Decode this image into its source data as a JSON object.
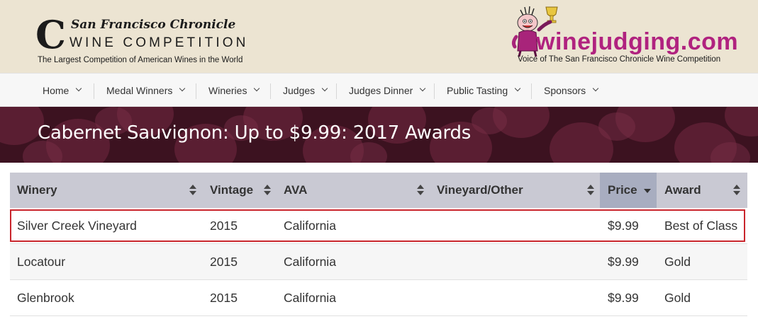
{
  "header": {
    "logo_letter": "C",
    "paper_name": "San Francisco Chronicle",
    "competition": "WINE COMPETITION",
    "tagline": "The Largest Competition of American Wines in the World",
    "winejudging_logo": "winejudging.com",
    "winejudging_voice": "Voice of The San Francisco Chronicle Wine Competition"
  },
  "nav": {
    "items": [
      {
        "label": "Home"
      },
      {
        "label": "Medal Winners"
      },
      {
        "label": "Wineries"
      },
      {
        "label": "Judges"
      },
      {
        "label": "Judges Dinner"
      },
      {
        "label": "Public Tasting"
      },
      {
        "label": "Sponsors"
      }
    ]
  },
  "banner": {
    "title": "Cabernet Sauvignon: Up to $9.99: 2017 Awards"
  },
  "table": {
    "columns": [
      "Winery",
      "Vintage",
      "AVA",
      "Vineyard/Other",
      "Price",
      "Award"
    ],
    "sorted_column": "Price",
    "rows": [
      {
        "winery": "Silver Creek Vineyard",
        "vintage": "2015",
        "ava": "California",
        "vineyard": "",
        "price": "$9.99",
        "award": "Best of Class"
      },
      {
        "winery": "Locatour",
        "vintage": "2015",
        "ava": "California",
        "vineyard": "",
        "price": "$9.99",
        "award": "Gold"
      },
      {
        "winery": "Glenbrook",
        "vintage": "2015",
        "ava": "California",
        "vineyard": "",
        "price": "$9.99",
        "award": "Gold"
      }
    ]
  },
  "colors": {
    "header_bg": "#ece4d2",
    "brand_magenta": "#b0227f",
    "banner_wine": "#4e1a2c",
    "table_header": "#c9c9d3",
    "sorted_header": "#a8adc0",
    "highlight": "#c9252c"
  },
  "icons": {
    "nav_caret": "chevron-down-icon",
    "sort": "sort-both-icon",
    "sort_active": "sort-down-icon",
    "mascot": "mascot-trophy-icon"
  }
}
